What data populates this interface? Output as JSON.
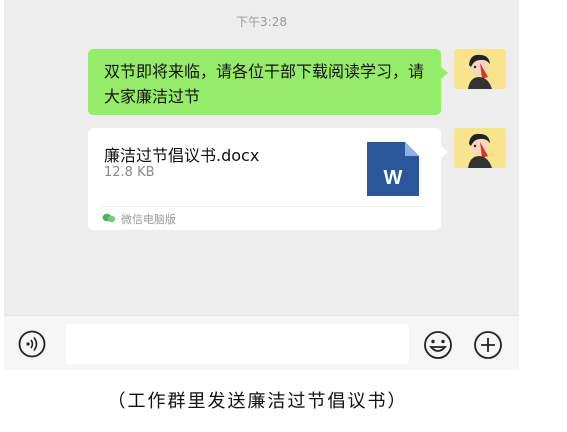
{
  "chat": {
    "timestamp": "下午3:28",
    "messages": [
      {
        "type": "text",
        "text": "双节即将来临，请各位干部下载阅读学习，请大家廉洁过节",
        "avatar": "avatar-icon"
      },
      {
        "type": "file",
        "file_name": "廉洁过节倡议书.docx",
        "file_size": "12.8 KB",
        "file_icon": "word-file-icon",
        "file_icon_letter": "W",
        "source": "微信电脑版",
        "source_icon": "wechat-icon",
        "avatar": "avatar-icon"
      }
    ]
  },
  "input_bar": {
    "voice_icon": "voice-icon",
    "emoji_icon": "emoji-icon",
    "plus_icon": "plus-icon"
  },
  "caption": "（工作群里发送廉洁过节倡议书）",
  "colors": {
    "chat_bg": "#ededed",
    "bubble_green": "#95ec69",
    "word_blue": "#2b579a",
    "avatar_bg": "#f7e48d"
  }
}
